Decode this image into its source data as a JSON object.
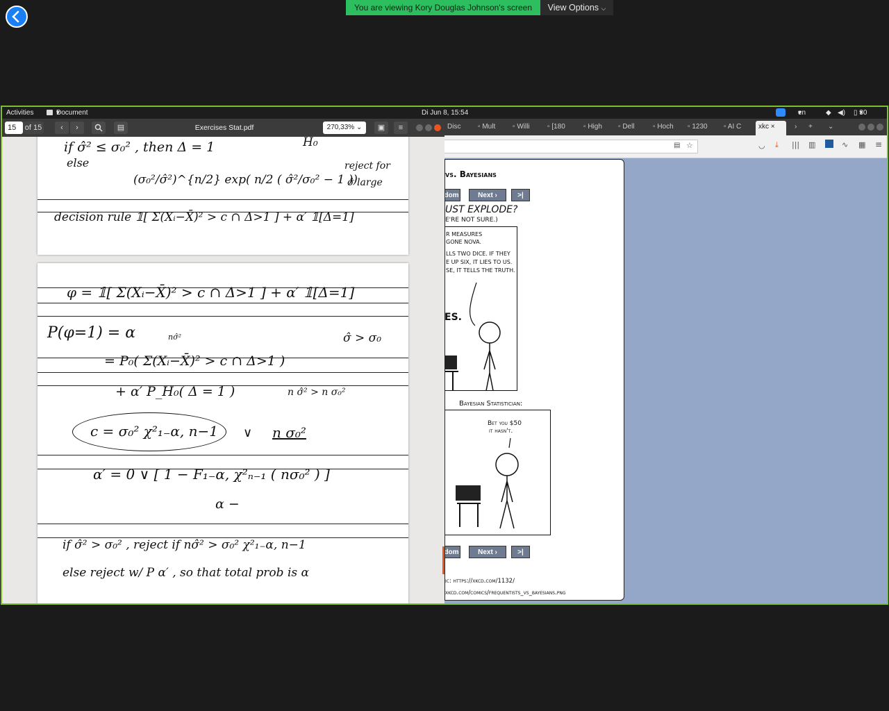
{
  "zoom": {
    "banner_text": "You are viewing Kory Douglas Johnson's screen",
    "view_options_label": "View Options"
  },
  "topbar": {
    "activities": "Activities",
    "app_menu": "Document Viewer",
    "clock": "Di Jun  8, 15:54",
    "language": "en",
    "battery": "30 %"
  },
  "docviewer": {
    "page_input": "15",
    "page_total": "of 15",
    "title": "Exercises Stat.pdf",
    "zoom_level": "270,33%"
  },
  "notes": {
    "p1_l1": "if  σ̂² ≤ σ₀² ,  then   Δ = 1",
    "p1_h0": "H₀",
    "p1_else": "else",
    "p1_l2": "(σ₀²/σ̂²)^{n/2} exp( n/2 ( σ̂²/σ₀² − 1 ))",
    "p1_reject": "reject for",
    "p1_large": "σ̂ large",
    "p1_rule": "decision rule   𝟙[ Σ(Xᵢ−X̄)² > c ∩ Δ>1 ] + α′ 𝟙[Δ=1]",
    "p2_l1": "φ  =  𝟙[ Σ(Xᵢ−X̄)² > c ∩ Δ>1 ] + α′ 𝟙[Δ=1]",
    "p2_l2": "P(φ=1) = α",
    "p2_l2b": "nσ̂²",
    "p2_l2c": "σ̂ > σ₀",
    "p2_l3": "= P₀( Σ(Xᵢ−X̄)² > c ∩ Δ>1 )",
    "p2_l4": "+ α′ P_H₀( Δ = 1 )",
    "p2_l4b": "n σ̂² > n σ₀²",
    "p2_box": "c = σ₀² χ²₁₋α, n−1",
    "p2_box_or": "∨",
    "p2_box_alt": "n σ₀²",
    "p2_l5": "α′ =     0   ∨  [ 1 − F₁₋α, χ²ₙ₋₁ ( nσ₀² ) ]",
    "p2_l6": "α −",
    "p2_l7": "if   σ̂² > σ₀² ,  reject if  nσ̂² > σ₀² χ²₁₋α, n−1",
    "p2_l8": "else   reject w/  P    α′ ,     so  that   total  prob  is    α"
  },
  "firefox": {
    "tabs": [
      "Disc",
      "Mult",
      "Willi",
      "[180",
      "High",
      "Dell",
      "Hoch",
      "1230",
      "AI C",
      "xkc"
    ],
    "active_tab_index": 9,
    "new_tab": "+"
  },
  "xkcd": {
    "title": "vs. Bayesians",
    "top_nav": {
      "random": "dom",
      "next": "Next ›",
      "last": ">|"
    },
    "bottom_nav": {
      "random": "dom",
      "next": "Next ›",
      "last": ">|"
    },
    "panel1_heading": "UST EXPLODE?",
    "panel1_sub": "E'RE NOT SURE.)",
    "panel1_text": [
      "R MEASURES",
      " GONE NOVA.",
      "LLS TWO DICE. IF THEY",
      "E UP SIX, IT LIES TO US.",
      "SE, IT TELLS THE TRUTH."
    ],
    "panel1_bottom": "ES.",
    "bayesian_label": "Bayesian Statistician:",
    "bet_text": [
      "Bet you $50",
      "it hasn't."
    ],
    "permalink": "ic: https://xkcd.com/1132/",
    "image_url": "xkcd.com/comics/frequentists_vs_bayesians.png"
  }
}
